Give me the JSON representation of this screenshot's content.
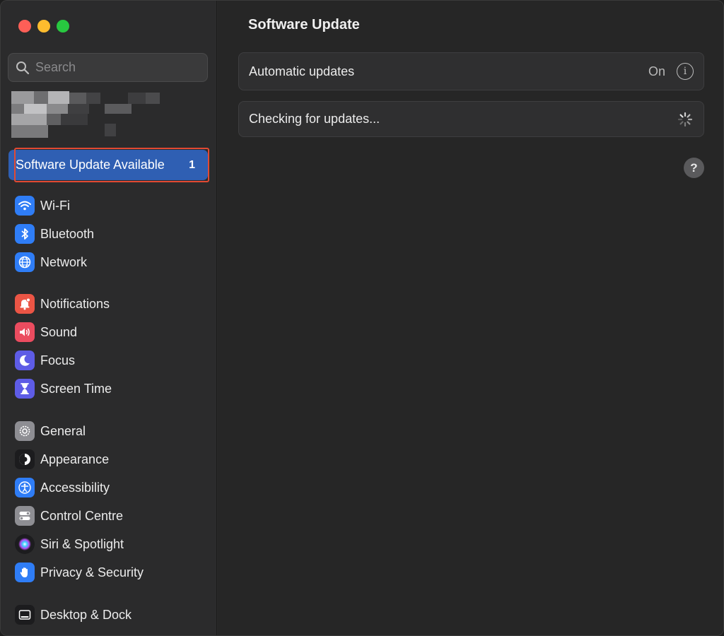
{
  "window": {
    "title": "Software Update"
  },
  "sidebar": {
    "search_placeholder": "Search",
    "update_item": {
      "label": "Software Update Available",
      "badge": "1"
    },
    "groups": [
      [
        {
          "label": "Wi-Fi",
          "icon": "wifi-icon",
          "color": "#2f7df6"
        },
        {
          "label": "Bluetooth",
          "icon": "bluetooth-icon",
          "color": "#2f7df6"
        },
        {
          "label": "Network",
          "icon": "globe-icon",
          "color": "#2f7df6"
        }
      ],
      [
        {
          "label": "Notifications",
          "icon": "bell-icon",
          "color": "#eb5545"
        },
        {
          "label": "Sound",
          "icon": "speaker-icon",
          "color": "#eb4c5f"
        },
        {
          "label": "Focus",
          "icon": "moon-icon",
          "color": "#5e5ce6"
        },
        {
          "label": "Screen Time",
          "icon": "hourglass-icon",
          "color": "#5e5ce6"
        }
      ],
      [
        {
          "label": "General",
          "icon": "gear-icon",
          "color": "#8e8e93"
        },
        {
          "label": "Appearance",
          "icon": "appearance-icon",
          "color": "#1c1c1e"
        },
        {
          "label": "Accessibility",
          "icon": "accessibility-icon",
          "color": "#2f7df6"
        },
        {
          "label": "Control Centre",
          "icon": "toggles-icon",
          "color": "#8e8e93"
        },
        {
          "label": "Siri & Spotlight",
          "icon": "siri-icon",
          "color": "#1c1c1e"
        },
        {
          "label": "Privacy & Security",
          "icon": "hand-icon",
          "color": "#2f7df6"
        }
      ],
      [
        {
          "label": "Desktop & Dock",
          "icon": "dock-icon",
          "color": "#1c1c1e"
        }
      ]
    ]
  },
  "main": {
    "title": "Software Update",
    "automatic_updates": {
      "label": "Automatic updates",
      "status": "On"
    },
    "checking": {
      "label": "Checking for updates..."
    },
    "help_label": "?"
  },
  "colors": {
    "accent": "#2f5fb3",
    "highlight_outline": "#e24a33",
    "traffic_red": "#fe5f57",
    "traffic_yellow": "#febc2e",
    "traffic_green": "#28c840"
  }
}
